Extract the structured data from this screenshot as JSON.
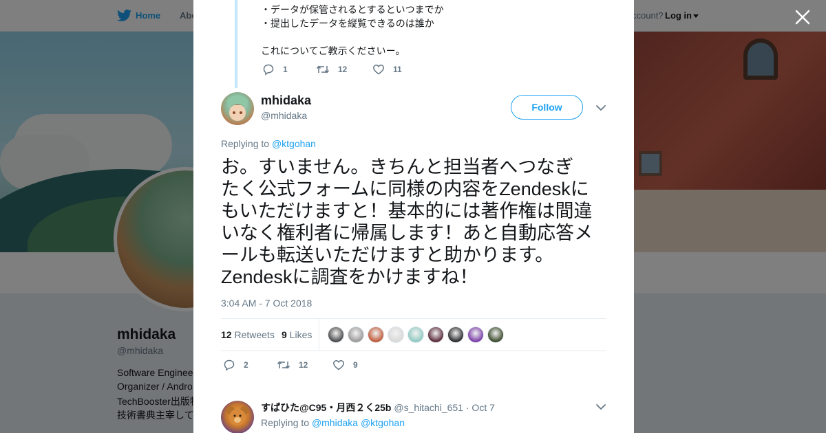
{
  "topnav": {
    "home_label": "Home",
    "about_label": "Abo",
    "account_text": "ccount?",
    "login_label": "Log in"
  },
  "profile": {
    "name": "mhidaka",
    "handle": "@mhidaka",
    "bio_lines": [
      "Software Enginee",
      "Organizer / Andro",
      "TechBooster出版物",
      "技術書典主宰して"
    ]
  },
  "previous_tweet": {
    "lines": [
      "・データが保管されるとするといつまでか",
      "・提出したデータを縦覧できるのは誰か",
      "これについてご教示くださいー。"
    ],
    "replies": "1",
    "retweets": "12",
    "likes": "11"
  },
  "tweet": {
    "author_name": "mhidaka",
    "author_handle": "@mhidaka",
    "follow_label": "Follow",
    "replying_prefix": "Replying to ",
    "replying_to": "@ktgohan",
    "text_lines": [
      "お。すいません。きちんと担当者へつなぎ",
      "たく公式フォームに同様の内容をZendeskに",
      "もいただけますと！基本的には著作権は間違",
      "いなく権利者に帰属します！あと自動応答メ",
      "ールも転送いただけますと助かります。",
      "Zendeskに調査をかけますね！"
    ],
    "timestamp": "3:04 AM - 7 Oct 2018",
    "retweet_count": "12",
    "retweet_label": " Retweets",
    "like_count": "9",
    "like_label": " Likes",
    "replies": "2",
    "retweets": "12",
    "likes": "9",
    "liker_colors": [
      "#4a4a4a",
      "#9a9a9a",
      "#c05a3a",
      "#d8d8d8",
      "#8fc9c0",
      "#5a2a3a",
      "#2a2a2a",
      "#7a3ea8",
      "#3a4a2a"
    ]
  },
  "reply": {
    "name": "すぱひた@C95・月西２く25b",
    "handle": " @s_hitachi_651",
    "date": " · Oct 7",
    "replying_prefix": "Replying to ",
    "replying_to_1": "@mhidaka",
    "replying_to_2": " @ktgohan"
  },
  "colors": {
    "accent": "#1da1f2",
    "text": "#14171a",
    "muted": "#657786"
  },
  "icons": [
    "bird-icon",
    "close-icon",
    "reply-icon",
    "retweet-icon",
    "heart-icon",
    "chevron-down-icon"
  ]
}
